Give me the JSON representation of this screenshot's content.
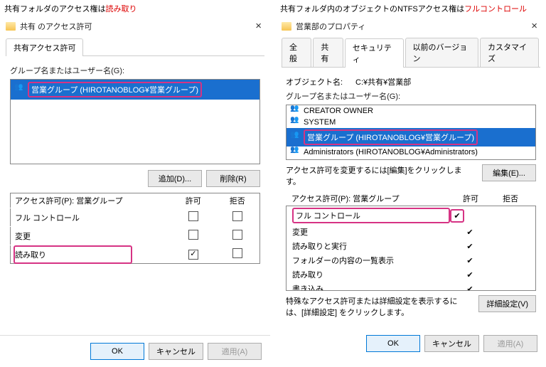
{
  "left": {
    "caption_base": "共有フォルダのアクセス権は",
    "caption_hl": "読み取り",
    "title": "共有 のアクセス許可",
    "tab": "共有アクセス許可",
    "group_label": "グループ名またはユーザー名(G):",
    "group_selected": "営業グループ (HIROTANOBLOG¥営業グループ)",
    "btn_add": "追加(D)...",
    "btn_remove": "削除(R)",
    "perm_label": "アクセス許可(P): 営業グループ",
    "col_allow": "許可",
    "col_deny": "拒否",
    "perms": [
      {
        "name": "フル コントロール",
        "allow": false,
        "deny": false
      },
      {
        "name": "変更",
        "allow": false,
        "deny": false
      },
      {
        "name": "読み取り",
        "allow": true,
        "deny": false,
        "hl": true
      }
    ],
    "ok": "OK",
    "cancel": "キャンセル",
    "apply": "適用(A)"
  },
  "right": {
    "caption_base": "共有フォルダ内のオブジェクトのNTFSアクセス権は",
    "caption_hl": "フルコントロール",
    "title": "営業部のプロパティ",
    "tabs": [
      "全般",
      "共有",
      "セキュリティ",
      "以前のバージョン",
      "カスタマイズ"
    ],
    "active_tab": 2,
    "obj_label": "オブジェクト名:",
    "obj_value": "C:¥共有¥営業部",
    "group_label": "グループ名またはユーザー名(G):",
    "groups": [
      {
        "name": "CREATOR OWNER"
      },
      {
        "name": "SYSTEM"
      },
      {
        "name": "営業グループ (HIROTANOBLOG¥営業グループ)",
        "selected": true,
        "hl": true
      },
      {
        "name": "Administrators (HIROTANOBLOG¥Administrators)"
      }
    ],
    "edit_hint": "アクセス許可を変更するには[編集]をクリックします。",
    "btn_edit": "編集(E)...",
    "perm_label": "アクセス許可(P): 営業グループ",
    "col_allow": "許可",
    "col_deny": "拒否",
    "perms": [
      {
        "name": "フル コントロール",
        "allow": true,
        "hl": true
      },
      {
        "name": "変更",
        "allow": true
      },
      {
        "name": "読み取りと実行",
        "allow": true
      },
      {
        "name": "フォルダーの内容の一覧表示",
        "allow": true
      },
      {
        "name": "読み取り",
        "allow": true
      },
      {
        "name": "書き込み",
        "allow": true
      }
    ],
    "adv_hint": "特殊なアクセス許可または詳細設定を表示するには、[詳細設定] をクリックします。",
    "btn_adv": "詳細設定(V)",
    "ok": "OK",
    "cancel": "キャンセル",
    "apply": "適用(A)"
  }
}
